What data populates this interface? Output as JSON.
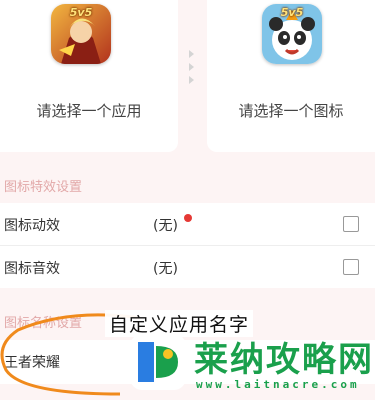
{
  "app_picker": {
    "left": {
      "badge": "5v5",
      "label": "请选择一个应用",
      "icon": "game-app-icon"
    },
    "right": {
      "badge": "5v5",
      "label": "请选择一个图标",
      "icon": "game-icon-panda"
    },
    "arrow_icon": "chevron-right-icon"
  },
  "effects_section": {
    "title": "图标特效设置",
    "rows": [
      {
        "label": "图标动效",
        "value": "(无)",
        "has_dot": true,
        "checked": false
      },
      {
        "label": "图标音效",
        "value": "(无)",
        "has_dot": false,
        "checked": false
      }
    ]
  },
  "name_section": {
    "title": "图标名称设置",
    "caption": "自定义应用名字",
    "input_value": "王者荣耀"
  },
  "watermark": {
    "title": "莱纳攻略网",
    "url": "www.laitnacre.com"
  },
  "colors": {
    "background": "#fdf4f4",
    "section_title": "#e2a8a8",
    "dot": "#e53935",
    "annotation": "#f08a1c",
    "watermark": "#1aa04c"
  }
}
